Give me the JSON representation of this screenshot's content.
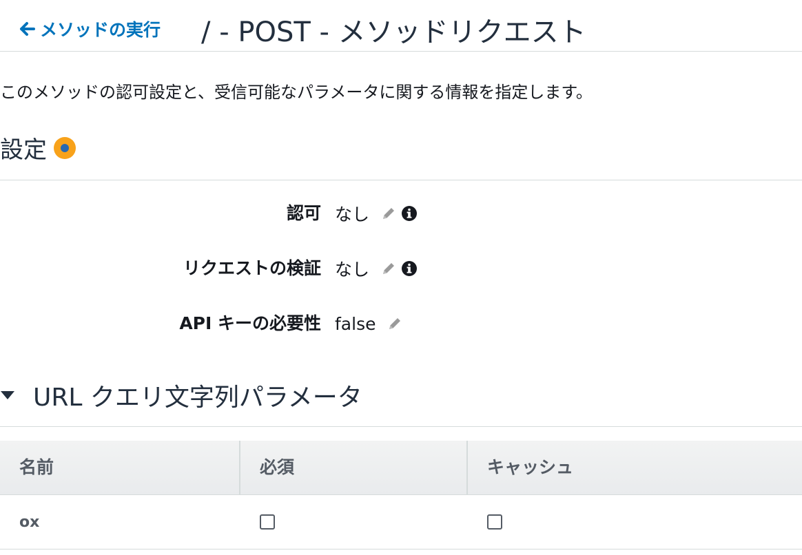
{
  "header": {
    "back_label": "メソッドの実行",
    "title": "/ - POST - メソッドリクエスト"
  },
  "description": "このメソッドの認可設定と、受信可能なパラメータに関する情報を指定します。",
  "settings": {
    "title": "設定",
    "rows": [
      {
        "label": "認可",
        "value": "なし",
        "has_info": true
      },
      {
        "label": "リクエストの検証",
        "value": "なし",
        "has_info": true
      },
      {
        "label": "API キーの必要性",
        "value": "false",
        "has_info": false
      }
    ]
  },
  "query_params": {
    "title": "URL クエリ文字列パラメータ",
    "expanded": true,
    "columns": [
      "名前",
      "必須",
      "キャッシュ"
    ],
    "rows": [
      {
        "name": "ox",
        "required": false,
        "caching": false
      }
    ]
  },
  "colors": {
    "link": "#0073bb",
    "status_dot_outer": "#f8a21a",
    "status_dot_inner": "#2868b0"
  },
  "icons": [
    "arrow-left-icon",
    "status-dot-icon",
    "pencil-icon",
    "info-icon",
    "caret-down-icon",
    "checkbox"
  ]
}
